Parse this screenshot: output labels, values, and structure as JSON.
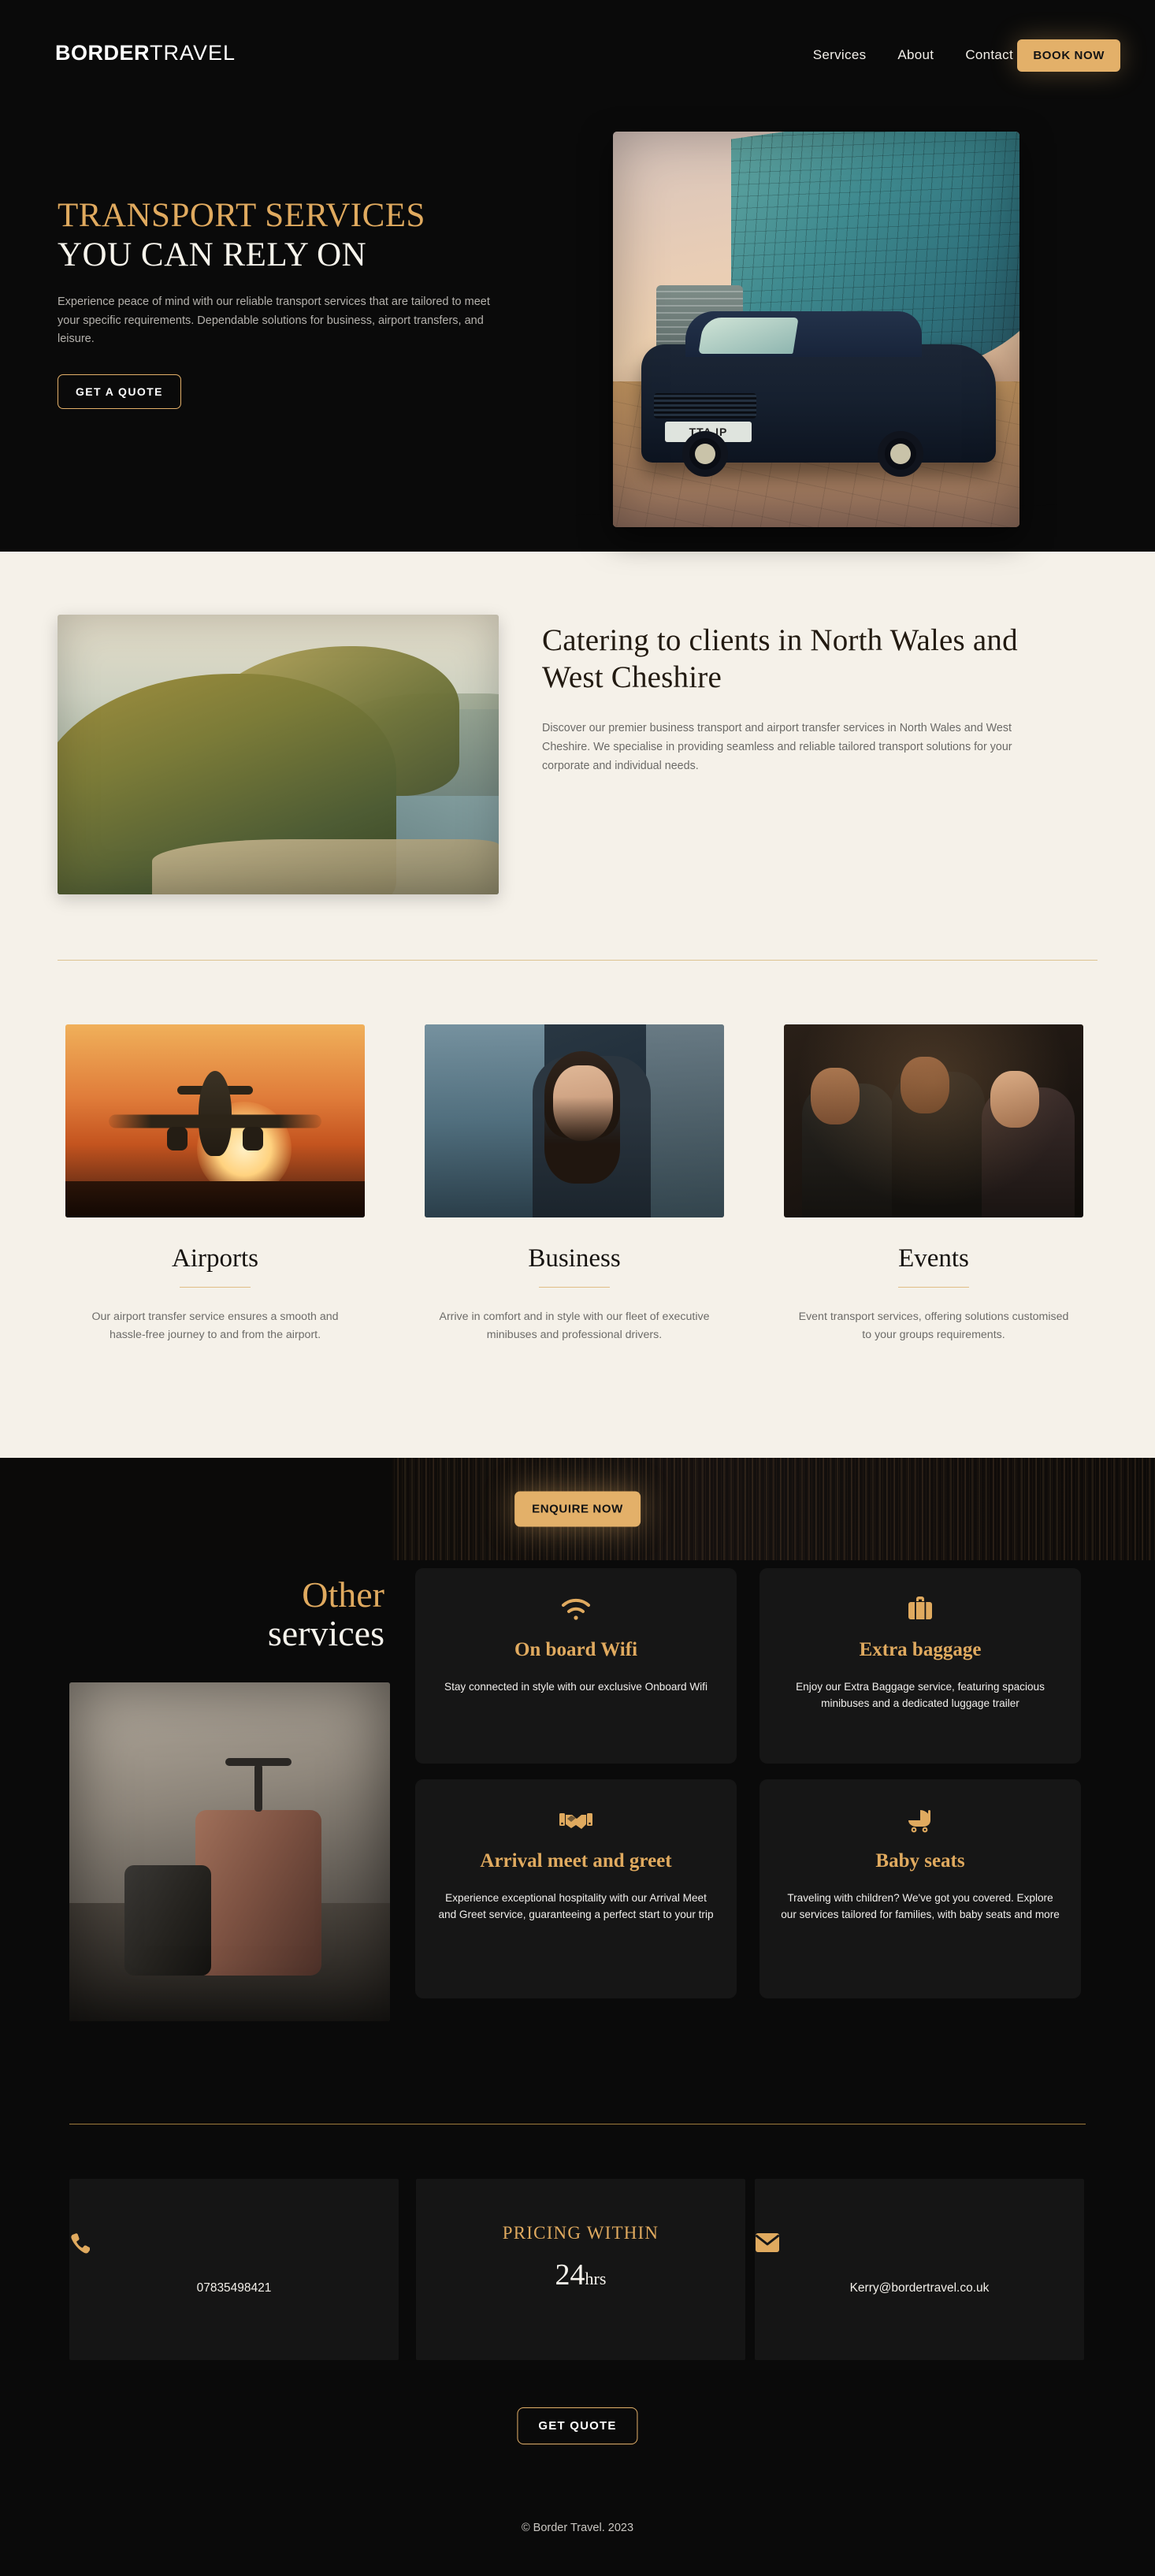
{
  "nav": {
    "logo_bold": "BORDER",
    "logo_light": "TRAVEL",
    "links": [
      {
        "label": "Services"
      },
      {
        "label": "About"
      },
      {
        "label": "Contact"
      }
    ],
    "cta_label": "BOOK NOW"
  },
  "hero": {
    "title_line1": "TRANSPORT SERVICES",
    "title_line2": "YOU CAN RELY ON",
    "paragraph": "Experience peace of mind with our reliable transport services that are tailored to meet your specific requirements. Dependable solutions for business, airport transfers, and leisure.",
    "cta_label": "GET A QUOTE",
    "image_alt": "black-minibus-outside-glass-building",
    "plate": "TTA IP"
  },
  "catering": {
    "heading": "Catering to clients in North Wales and West Cheshire",
    "paragraph": "Discover our premier business transport and airport transfer services in North Wales and West Cheshire. We specialise in providing seamless and reliable tailored transport solutions for your corporate and individual needs.",
    "image_alt": "coastal-hills-aerial-view"
  },
  "services": [
    {
      "title": "Airports",
      "text": "Our airport transfer service ensures a smooth and hassle-free journey to and from the airport.",
      "image_alt": "airplane-landing-at-sunset"
    },
    {
      "title": "Business",
      "text": "Arrive in comfort and in style with our fleet of executive minibuses and professional drivers.",
      "image_alt": "businesswoman-in-vehicle"
    },
    {
      "title": "Events",
      "text": "Event transport services, offering solutions customised to your groups requirements.",
      "image_alt": "guests-in-formal-wear-celebrating"
    }
  ],
  "band": {
    "cta_label": "ENQUIRE NOW",
    "background_alt": "night-city-skyline"
  },
  "other": {
    "heading_line1": "Other",
    "heading_line2": "services",
    "image_alt": "two-suitcases-in-corridor",
    "cards": [
      {
        "icon": "wifi-icon",
        "title": "On board Wifi",
        "text": "Stay connected in style with our exclusive Onboard Wifi"
      },
      {
        "icon": "suitcase-icon",
        "title": "Extra baggage",
        "text": "Enjoy our Extra Baggage service, featuring spacious minibuses and a dedicated luggage trailer"
      },
      {
        "icon": "handshake-icon",
        "title": "Arrival meet and greet",
        "text": "Experience exceptional hospitality with our Arrival Meet and Greet service, guaranteeing a perfect start to your trip"
      },
      {
        "icon": "stroller-icon",
        "title": "Baby seats",
        "text": "Traveling with children? We've got you covered. Explore our services tailored for families, with baby seats and more"
      }
    ]
  },
  "contact": {
    "phone": {
      "icon": "phone-icon",
      "value": "07835498421"
    },
    "pricing": {
      "label": "PRICING WITHIN",
      "number": "24",
      "unit": "hrs"
    },
    "email": {
      "icon": "envelope-icon",
      "value": "Kerry@bordertravel.co.uk"
    }
  },
  "footer": {
    "cta_label": "GET QUOTE",
    "copyright": "© Border Travel. 2023"
  },
  "colors": {
    "gold": "#e3b069",
    "gold_text": "#e0aa5f",
    "dark": "#0a0a0a",
    "cream": "#f5f1e9",
    "card_dark": "#161616"
  }
}
